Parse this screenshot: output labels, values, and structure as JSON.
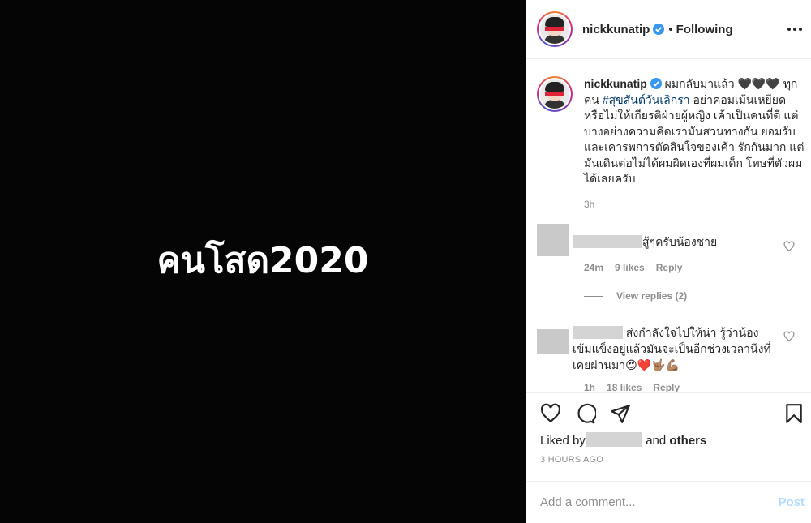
{
  "media": {
    "text": "คนโสด2020"
  },
  "header": {
    "username": "nickkunatip",
    "separator": "•",
    "follow_status": "Following"
  },
  "caption": {
    "username": "nickkunatip",
    "text_before_hashtag": " ผมกลับมาแล้ว 🖤🖤🖤 ทุกคน ",
    "hashtag": "#สุขสันต์วันเลิกรา",
    "text_after_hashtag": " อย่าคอมเม้นเหยียดหรือไม่ให้เกียรติฝ่ายผู้หญิง เค้าเป็นคนที่ดี แต่บางอย่างความคิดเรามันสวนทางกัน ยอมรับและเคารพการตัดสินใจของเค้า รักกันมาก แต่มันเดินต่อไม่ได้ผมผิดเองที่ผมเด็ก โทษที่ตัวผมได้เลยครับ",
    "timestamp": "3h"
  },
  "comments": [
    {
      "text": "สู้ๆครับน้องชาย",
      "time": "24m",
      "likes": "9 likes",
      "reply": "Reply"
    },
    {
      "text": " ส่งกำลังใจไปให้น่า รู้ว่าน้องเข้มแข็งอยู่แล้วมันจะเป็นอีกช่วงเวลานึงที่เคยผ่านมา😍❤️🤟🏽💪🏽",
      "time": "1h",
      "likes": "18 likes",
      "reply": "Reply"
    }
  ],
  "view_replies": "View replies (2)",
  "likes": {
    "prefix": "Liked by",
    "middle": "and",
    "others": "others"
  },
  "time_ago": "3 HOURS AGO",
  "add_comment": {
    "placeholder": "Add a comment...",
    "post": "Post"
  },
  "colors": {
    "accent_link": "#00376b",
    "post_disabled": "#b3dbff",
    "verified": "#3897f0"
  }
}
